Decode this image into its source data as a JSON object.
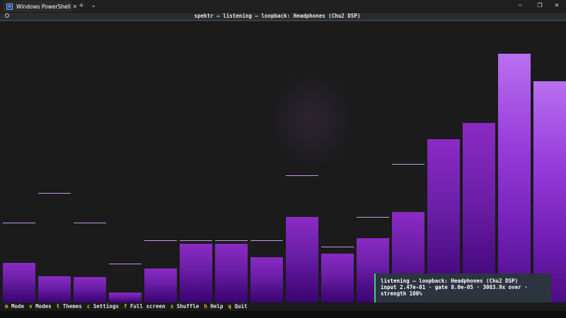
{
  "window": {
    "tab_label": "Windows PowerShell",
    "tab_close": "✕",
    "new_tab": "+",
    "dropdown": "⌄",
    "minimize": "─",
    "maximize": "❐",
    "close": "✕"
  },
  "header": {
    "title": "spektr — listening — loopback: Headphones (Chu2 DSP)"
  },
  "spectrum": {
    "max_level": 352,
    "bars": [
      {
        "level": 56,
        "peak": 113
      },
      {
        "level": 37,
        "peak": 155
      },
      {
        "level": 36,
        "peak": 113
      },
      {
        "level": 14,
        "peak": 55
      },
      {
        "level": 48,
        "peak": 88
      },
      {
        "level": 83,
        "peak": 88
      },
      {
        "level": 83,
        "peak": 88
      },
      {
        "level": 64,
        "peak": 88
      },
      {
        "level": 121,
        "peak": 180
      },
      {
        "level": 69,
        "peak": 79
      },
      {
        "level": 91,
        "peak": 121
      },
      {
        "level": 128,
        "peak": 196
      },
      {
        "level": 231,
        "peak": null
      },
      {
        "level": 254,
        "peak": null
      },
      {
        "level": 352,
        "peak": null
      },
      {
        "level": 313,
        "peak": null
      }
    ]
  },
  "status": {
    "line1": "listening — loopback: Headphones (Chu2 DSP)",
    "line2": "input 2.47e-01 · gate 8.0e-05 · 3083.9x over · strength 100%"
  },
  "footer": {
    "items": [
      {
        "key": "m",
        "label": "Mode"
      },
      {
        "key": "v",
        "label": "Modes"
      },
      {
        "key": "t",
        "label": "Themes"
      },
      {
        "key": "c",
        "label": "Settings"
      },
      {
        "key": "f",
        "label": "Full screen"
      },
      {
        "key": "s",
        "label": "Shuffle"
      },
      {
        "key": "h",
        "label": "Help"
      },
      {
        "key": "q",
        "label": "Quit"
      }
    ]
  },
  "colors": {
    "accent": "#8a2bc4",
    "peak": "#c69ae6",
    "status_border": "#3fd07a",
    "key": "#e8b13b"
  }
}
